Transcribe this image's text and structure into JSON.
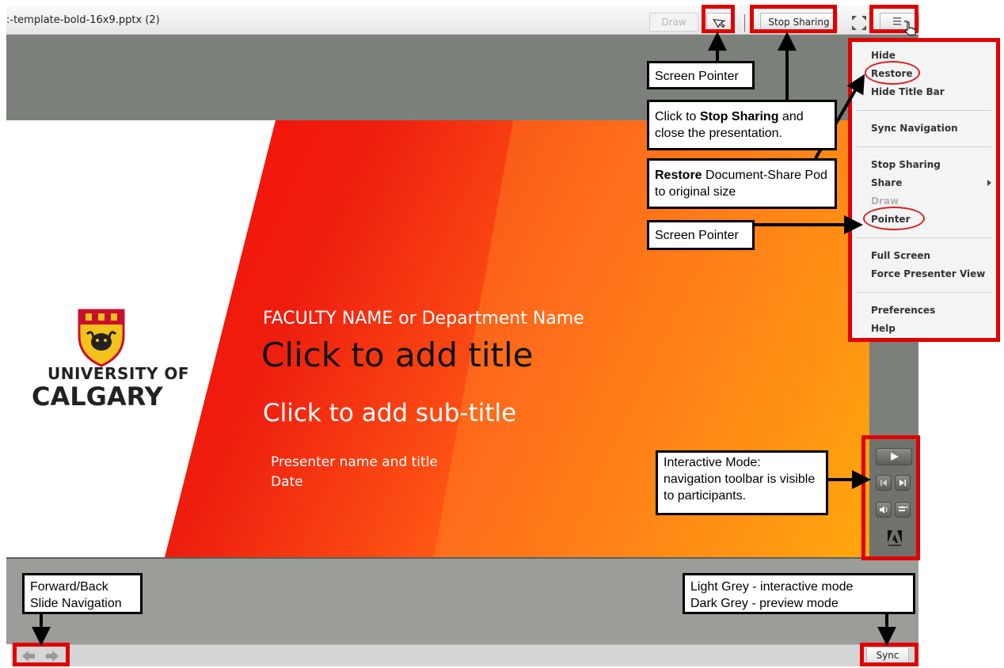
{
  "titlebar": {
    "doc_title": ":-template-bold-16x9.pptx (2)",
    "draw_label": "Draw",
    "stop_sharing_label": "Stop Sharing",
    "pointer_icon": "pointer-arrow-icon",
    "fullscreen_icon": "fullscreen-icon",
    "menu_icon": "hamburger-menu-icon"
  },
  "slide": {
    "university_line1": "UNIVERSITY OF",
    "university_line2": "CALGARY",
    "faculty": "FACULTY NAME or Department Name",
    "title": "Click to add title",
    "subtitle": "Click to add sub-title",
    "presenter": "Presenter name and title",
    "date": "Date"
  },
  "menu": {
    "items": [
      {
        "label": "Hide"
      },
      {
        "label": "Restore"
      },
      {
        "label": "Hide Title Bar"
      },
      {
        "label": "Sync Navigation"
      },
      {
        "label": "Stop Sharing"
      },
      {
        "label": "Share"
      },
      {
        "label": "Draw"
      },
      {
        "label": "Pointer"
      },
      {
        "label": "Full Screen"
      },
      {
        "label": "Force Presenter View"
      },
      {
        "label": "Preferences"
      },
      {
        "label": "Help"
      }
    ]
  },
  "callouts": {
    "screen_pointer_top": "Screen Pointer",
    "stop_pre": "Click to ",
    "stop_bold": "Stop Sharing",
    "stop_post": " and close the presentation.",
    "restore_bold": "Restore",
    "restore_post": " Document-Share Pod to original size",
    "screen_pointer_mid": "Screen Pointer",
    "interactive": "Interactive Mode: navigation toolbar is visible to participants.",
    "fwd_back": "Forward/Back Slide Navigation",
    "grey_line1": "Light Grey - interactive mode",
    "grey_line2": "Dark Grey - preview mode"
  },
  "bottombar": {
    "sync_label": "Sync"
  },
  "colors": {
    "highlight": "#e00000",
    "pod_grey": "#7c807a",
    "slide_red": "#ee1e0f",
    "slide_orange": "#ff8e0b"
  }
}
